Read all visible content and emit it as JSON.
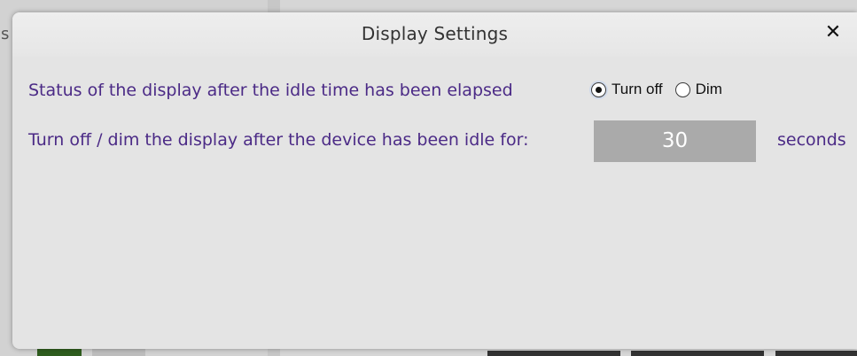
{
  "dialog": {
    "title": "Display Settings",
    "close_label": "✕"
  },
  "settings": {
    "status_label": "Status of the display after the idle time has been elapsed",
    "idle_label": "Turn off / dim the display after the device has been idle for:",
    "radio_options": [
      {
        "label": "Turn off",
        "selected": true
      },
      {
        "label": "Dim",
        "selected": false
      }
    ],
    "idle_value": "30",
    "unit": "seconds"
  },
  "background": {
    "edge_char": "s"
  },
  "colors": {
    "label_text": "#4b2a86",
    "input_bg": "#aaaaaa",
    "dialog_bg": "#e4e4e4"
  }
}
